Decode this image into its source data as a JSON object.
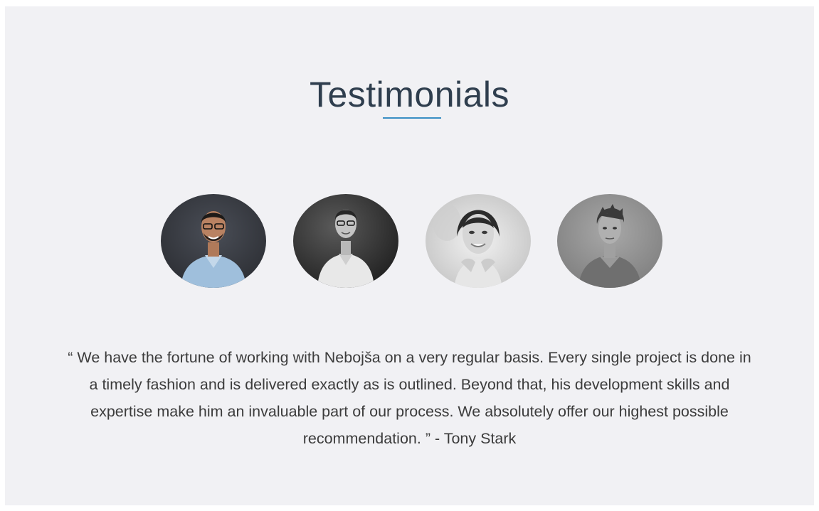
{
  "section": {
    "title": "Testimonials",
    "accent_color": "#3a8fc4",
    "background_color": "#f1f1f4"
  },
  "avatars": [
    {
      "icon": "person-photo-icon",
      "description_style": "color"
    },
    {
      "icon": "person-photo-icon",
      "description_style": "grayscale"
    },
    {
      "icon": "person-photo-icon",
      "description_style": "grayscale"
    },
    {
      "icon": "person-photo-icon",
      "description_style": "grayscale"
    }
  ],
  "testimonial": {
    "text": "“ We have the fortune of working with Nebojša on a very regular basis. Every single project is done in a timely fashion and is delivered exactly as is outlined. Beyond that, his development skills and expertise make him an invaluable part of our process. We absolutely offer our highest possible recommendation. ” - Tony Stark"
  }
}
